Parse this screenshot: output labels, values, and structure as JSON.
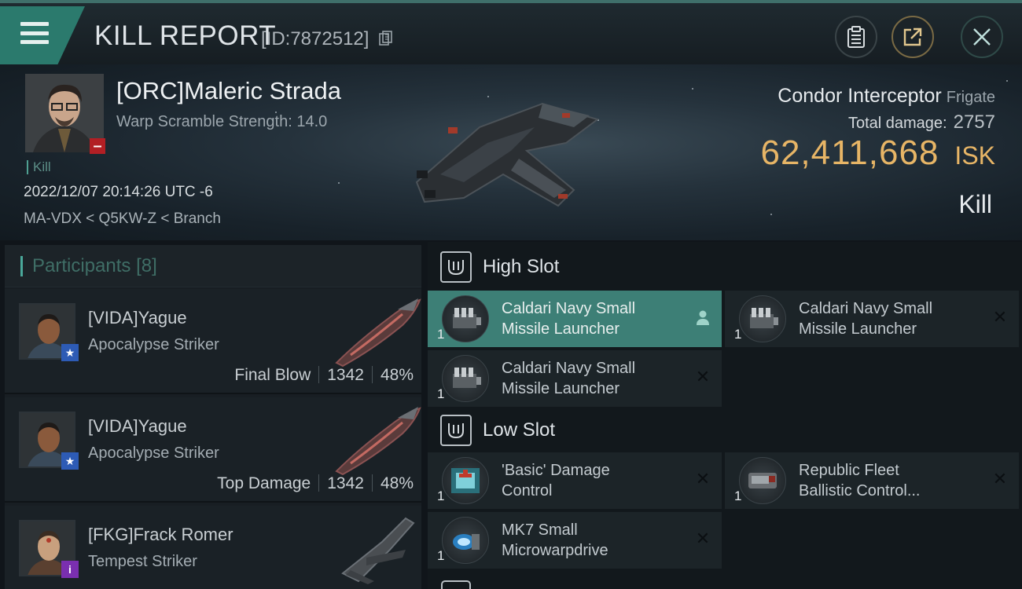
{
  "header": {
    "title": "KILL REPORT",
    "report_id": "[ID:7872512]"
  },
  "victim": {
    "name": "[ORC]Maleric Strada",
    "warp_scramble": "Warp Scramble Strength: 14.0",
    "kill_tag": "Kill",
    "datetime": "2022/12/07 20:14:26 UTC -6",
    "location": "MA-VDX < Q5KW-Z < Branch",
    "ship_name": "Condor Interceptor",
    "ship_class": "Frigate",
    "total_damage_label": "Total damage:",
    "total_damage": "2757",
    "isk_value": "62,411,668",
    "isk_unit": "ISK",
    "kill_type": "Kill"
  },
  "participants": {
    "title": "Participants",
    "count": "[8]",
    "items": [
      {
        "name": "[VIDA]Yague",
        "ship": "Apocalypse Striker",
        "role": "Final Blow",
        "damage": "1342",
        "percent": "48%",
        "badge": "★",
        "badge_color": "#2d5bb5"
      },
      {
        "name": "[VIDA]Yague",
        "ship": "Apocalypse Striker",
        "role": "Top Damage",
        "damage": "1342",
        "percent": "48%",
        "badge": "★",
        "badge_color": "#2d5bb5"
      },
      {
        "name": "[FKG]Frack Romer",
        "ship": "Tempest Striker",
        "badge": "i",
        "badge_color": "#7a2fb0"
      }
    ]
  },
  "fitting": {
    "high_slot": {
      "title": "High Slot",
      "modules": [
        {
          "qty": "1",
          "line1": "Caldari Navy Small",
          "line2": "Missile Launcher",
          "icon": "missile-launcher-icon",
          "selected": true
        },
        {
          "qty": "1",
          "line1": "Caldari Navy Small",
          "line2": "Missile Launcher",
          "icon": "missile-launcher-icon",
          "selected": false
        },
        {
          "qty": "1",
          "line1": "Caldari Navy Small",
          "line2": "Missile Launcher",
          "icon": "missile-launcher-icon",
          "selected": false
        }
      ]
    },
    "low_slot": {
      "title": "Low Slot",
      "modules": [
        {
          "qty": "1",
          "line1": "'Basic' Damage",
          "line2": "Control",
          "icon": "damage-control-icon"
        },
        {
          "qty": "1",
          "line1": "Republic Fleet",
          "line2": "Ballistic Control...",
          "icon": "ballistic-control-icon"
        },
        {
          "qty": "1",
          "line1": "MK7 Small",
          "line2": "Microwarpdrive",
          "icon": "microwarpdrive-icon"
        }
      ]
    }
  },
  "colors": {
    "accent": "#3d7f76",
    "isk": "#e7b566",
    "header_teal": "#2b7a6d"
  }
}
